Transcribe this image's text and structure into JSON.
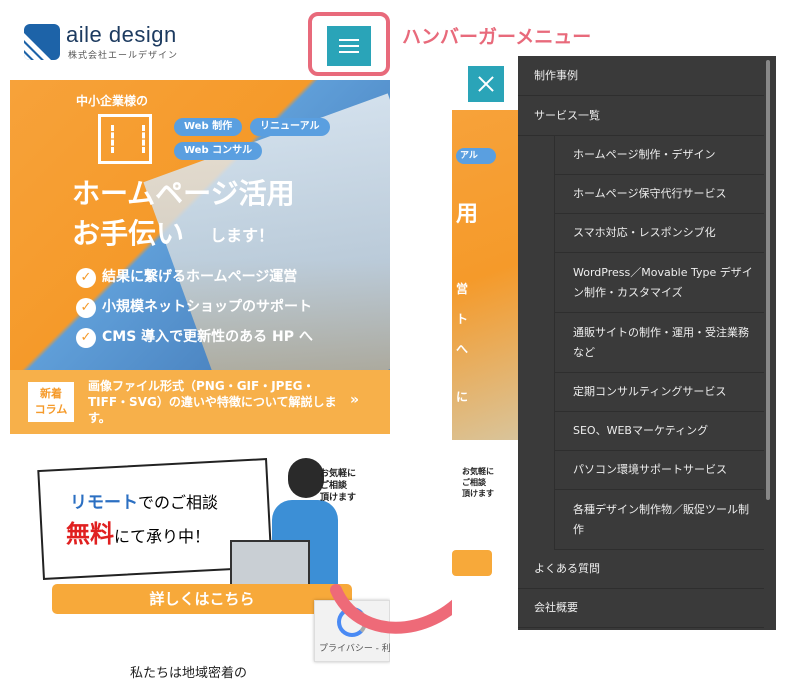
{
  "annotation": "ハンバーガーメニュー",
  "header": {
    "logo_name": "aile design",
    "logo_sub": "株式会社エールデザイン"
  },
  "hero": {
    "kicker": "中小企業様の",
    "pills": [
      "Web 制作",
      "リニューアル",
      "Web コンサル"
    ],
    "title_line1": "ホームページ活用",
    "title_line2": "お手伝い",
    "title_line2_small": "します！",
    "checks": [
      "結果に繋げるホームページ運営",
      "小規模ネットショップのサポート",
      "CMS 導入で更新性のある HP へ"
    ]
  },
  "news": {
    "tag": "新着\nコラム",
    "text": "画像ファイル形式（PNG・GIF・JPEG・TIFF・SVG）の違いや特徴について解説します。",
    "arrow": "»"
  },
  "remote": {
    "line1_blue": "リモート",
    "line1_rest": "でのご相談",
    "line2_red": "無料",
    "line2_rest": "にて承り中！",
    "bubble": "お気軽に\nご相談\n頂けます",
    "cta": "詳しくはこちら",
    "footer_text": "私たちは地域密着の"
  },
  "recaptcha": {
    "text": "プライバシー - 利用規約"
  },
  "right_page_fragments": {
    "pill": "アル",
    "title": "用",
    "check1": "営",
    "check2": "ト",
    "check3": "へ",
    "news_frag": "に",
    "remote_frag": "お気軽に\nご相談\n頂けます"
  },
  "menu": {
    "items": [
      {
        "label": "制作事例",
        "sub": false
      },
      {
        "label": "サービス一覧",
        "sub": false
      },
      {
        "label": "ホームページ制作・デザイン",
        "sub": true
      },
      {
        "label": "ホームページ保守代行サービス",
        "sub": true
      },
      {
        "label": "スマホ対応・レスポンシブ化",
        "sub": true
      },
      {
        "label": "WordPress／Movable Type デザイン制作・カスタマイズ",
        "sub": true
      },
      {
        "label": "通販サイトの制作・運用・受注業務など",
        "sub": true
      },
      {
        "label": "定期コンサルティングサービス",
        "sub": true
      },
      {
        "label": "SEO、WEBマーケティング",
        "sub": true
      },
      {
        "label": "パソコン環境サポートサービス",
        "sub": true
      },
      {
        "label": "各種デザイン制作物／販促ツール制作",
        "sub": true
      },
      {
        "label": "よくある質問",
        "sub": false
      },
      {
        "label": "会社概要",
        "sub": false
      }
    ]
  },
  "colors": {
    "accent_teal": "#2aa4b8",
    "annotation_pink": "#e86a7b",
    "orange": "#f59a2a",
    "menu_bg": "#3a3a3a"
  }
}
